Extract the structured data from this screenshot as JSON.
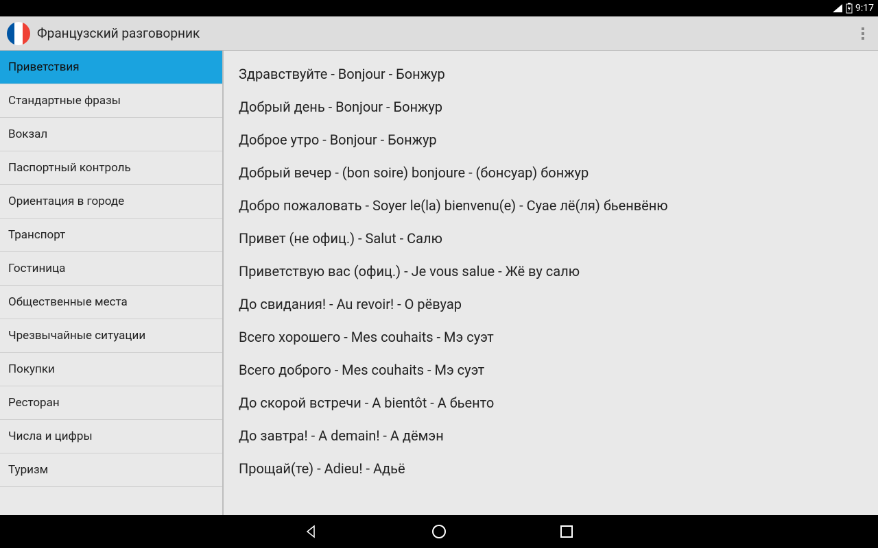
{
  "status": {
    "time": "9:17"
  },
  "header": {
    "title": "Французский разговорник"
  },
  "sidebar": {
    "items": [
      {
        "label": "Приветствия",
        "active": true
      },
      {
        "label": "Стандартные фразы",
        "active": false
      },
      {
        "label": "Вокзал",
        "active": false
      },
      {
        "label": "Паспортный контроль",
        "active": false
      },
      {
        "label": "Ориентация в городе",
        "active": false
      },
      {
        "label": "Транспорт",
        "active": false
      },
      {
        "label": "Гостиница",
        "active": false
      },
      {
        "label": "Общественные места",
        "active": false
      },
      {
        "label": "Чрезвычайные ситуации",
        "active": false
      },
      {
        "label": "Покупки",
        "active": false
      },
      {
        "label": "Ресторан",
        "active": false
      },
      {
        "label": "Числа и цифры",
        "active": false
      },
      {
        "label": "Туризм",
        "active": false
      }
    ]
  },
  "phrases": [
    "Здравствуйте - Bonjour - Бонжур",
    "Добрый день - Bonjour - Бонжур",
    "Доброе утро - Bonjour - Бонжур",
    "Добрый вечер - (bon soire) bonjoure - (бонсуар) бонжур",
    "Добро пожаловать - Soyer le(la) bienvenu(e) - Суае лё(ля) бьенвёню",
    "Привет (не офиц.) - Salut - Салю",
    "Приветствую вас (офиц.) - Je vous salue - Жё ву салю",
    "До свидания! - Au revoir! - О рёвуар",
    "Всего хорошего - Mes couhaits - Мэ суэт",
    "Всего доброго - Mes couhaits - Мэ суэт",
    "До скорой встречи - A bientôt - А бьенто",
    "До завтра! - A demain! - А дёмэн",
    "Прощай(те) - Adieu! - Адьё"
  ]
}
